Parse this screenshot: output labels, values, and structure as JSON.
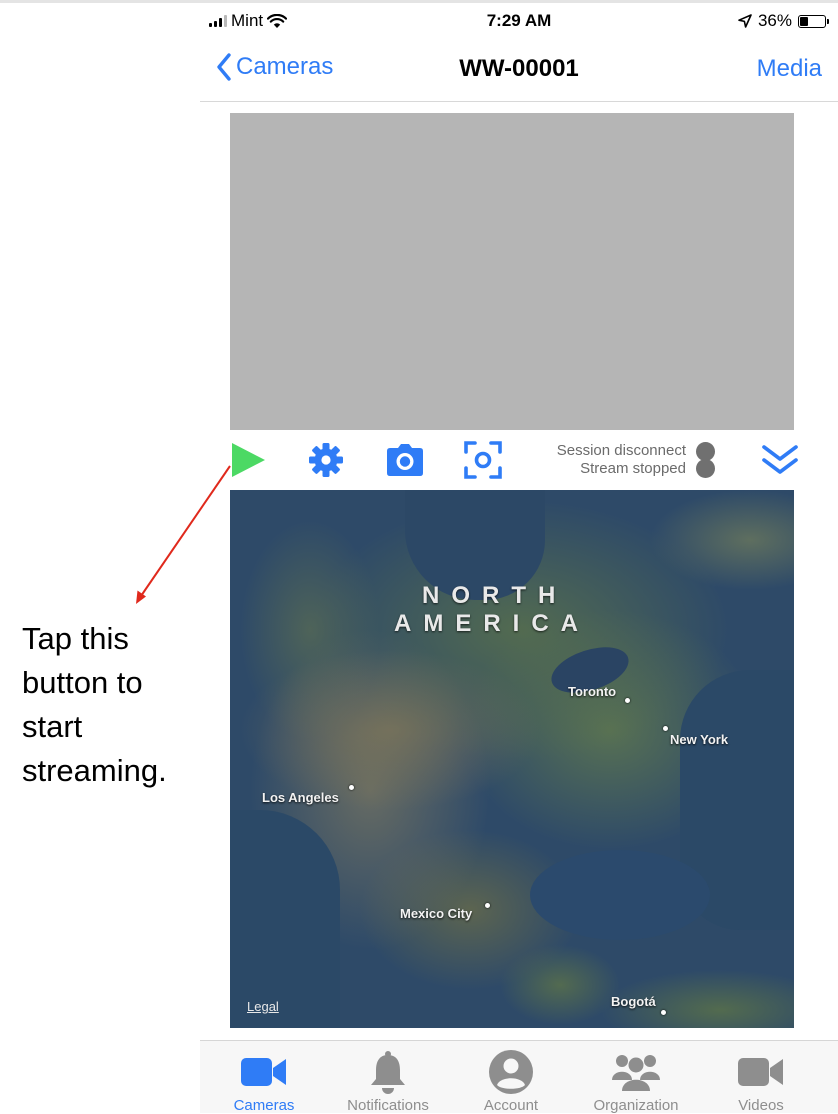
{
  "status_bar": {
    "carrier": "Mint",
    "time": "7:29 AM",
    "battery": "36%",
    "battery_level": 0.36
  },
  "nav": {
    "back_label": "Cameras",
    "title": "WW-00001",
    "right_label": "Media"
  },
  "controls": {
    "session_status": "Session disconnect",
    "stream_status": "Stream stopped",
    "play_color": "#4cd964",
    "accent_color": "#2f7cf6"
  },
  "map": {
    "region_line1": "NORTH",
    "region_line2": "AMERICA",
    "cities": [
      "Toronto",
      "New York",
      "Los Angeles",
      "Mexico City",
      "Bogotá"
    ],
    "legal": "Legal"
  },
  "tabs": [
    {
      "label": "Cameras",
      "icon": "video-camera-icon",
      "active": true
    },
    {
      "label": "Notifications",
      "icon": "bell-icon",
      "active": false
    },
    {
      "label": "Account",
      "icon": "user-icon",
      "active": false
    },
    {
      "label": "Organization",
      "icon": "group-icon",
      "active": false
    },
    {
      "label": "Videos",
      "icon": "video-camera-icon",
      "active": false
    }
  ],
  "annotation": {
    "text": "Tap this button to start streaming.",
    "arrow_color": "#e0291c"
  }
}
